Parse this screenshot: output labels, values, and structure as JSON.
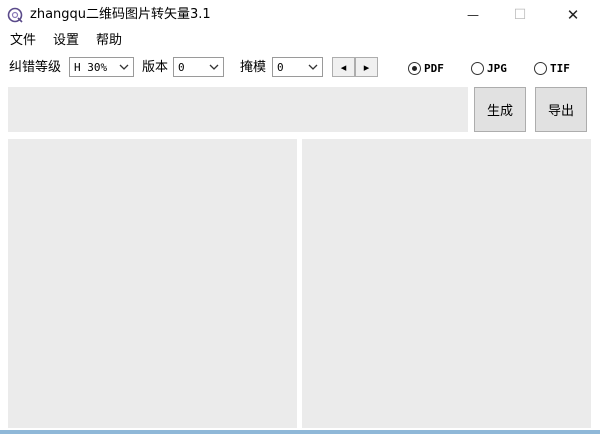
{
  "window": {
    "title": "zhangqu二维码图片转矢量3.1",
    "minimize_glyph": "—",
    "maximize_glyph": "☐",
    "close_glyph": "✕"
  },
  "menu": {
    "items": [
      {
        "label": "文件"
      },
      {
        "label": "设置"
      },
      {
        "label": "帮助"
      }
    ]
  },
  "toolbar": {
    "error_level": {
      "label": "纠错等级",
      "value": "H 30%"
    },
    "version": {
      "label": "版本",
      "value": "0"
    },
    "mask": {
      "label": "掩模",
      "value": "0"
    },
    "spin_left_glyph": "◂",
    "spin_right_glyph": "▸",
    "formats": [
      {
        "label": "PDF",
        "checked": true
      },
      {
        "label": "JPG",
        "checked": false
      },
      {
        "label": "TIF",
        "checked": false
      }
    ]
  },
  "actions": {
    "generate_label": "生成",
    "export_label": "导出"
  },
  "colors": {
    "panel_bg": "#ebebeb",
    "button_bg": "#e1e1e1",
    "accent": "#8fb8d8"
  }
}
